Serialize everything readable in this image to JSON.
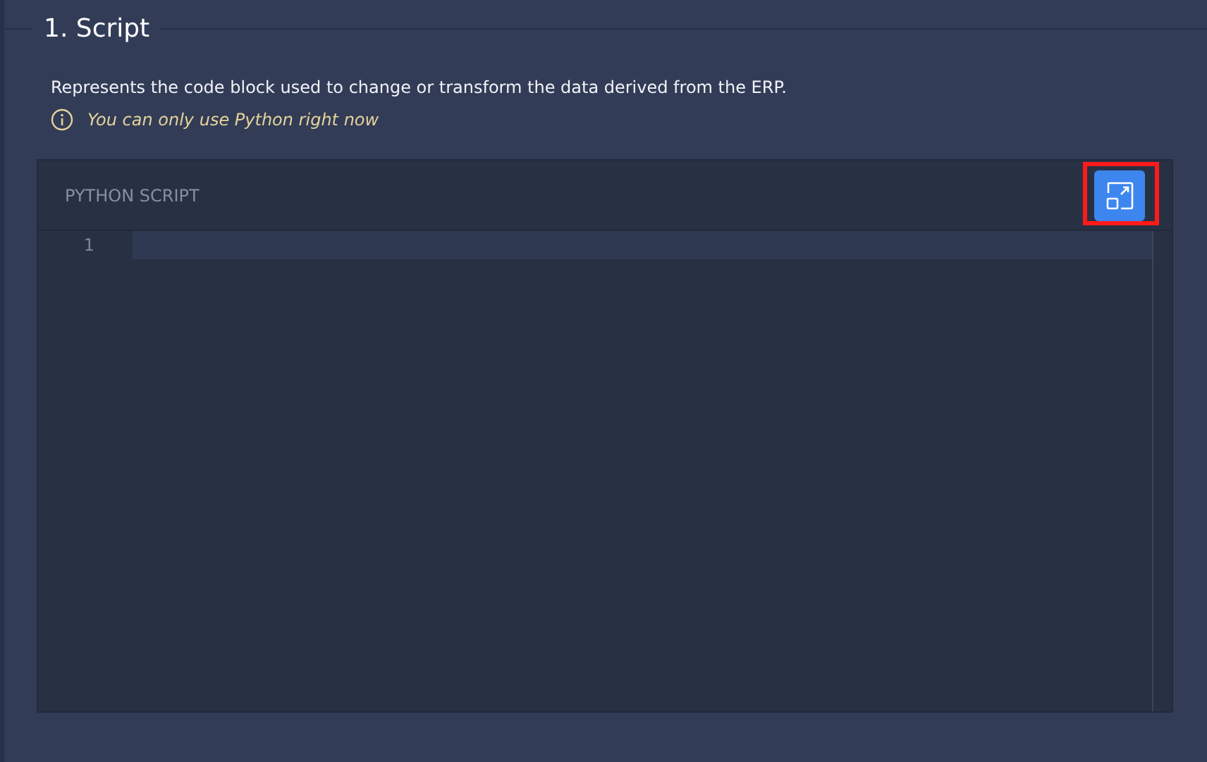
{
  "section": {
    "title": "1. Script",
    "description": "Represents the code block used to change or transform the data derived from the ERP.",
    "hint": "You can only use Python right now"
  },
  "editor": {
    "title": "PYTHON SCRIPT",
    "expand_highlighted": true,
    "lines": [
      {
        "number": "1",
        "active": true
      }
    ]
  }
}
